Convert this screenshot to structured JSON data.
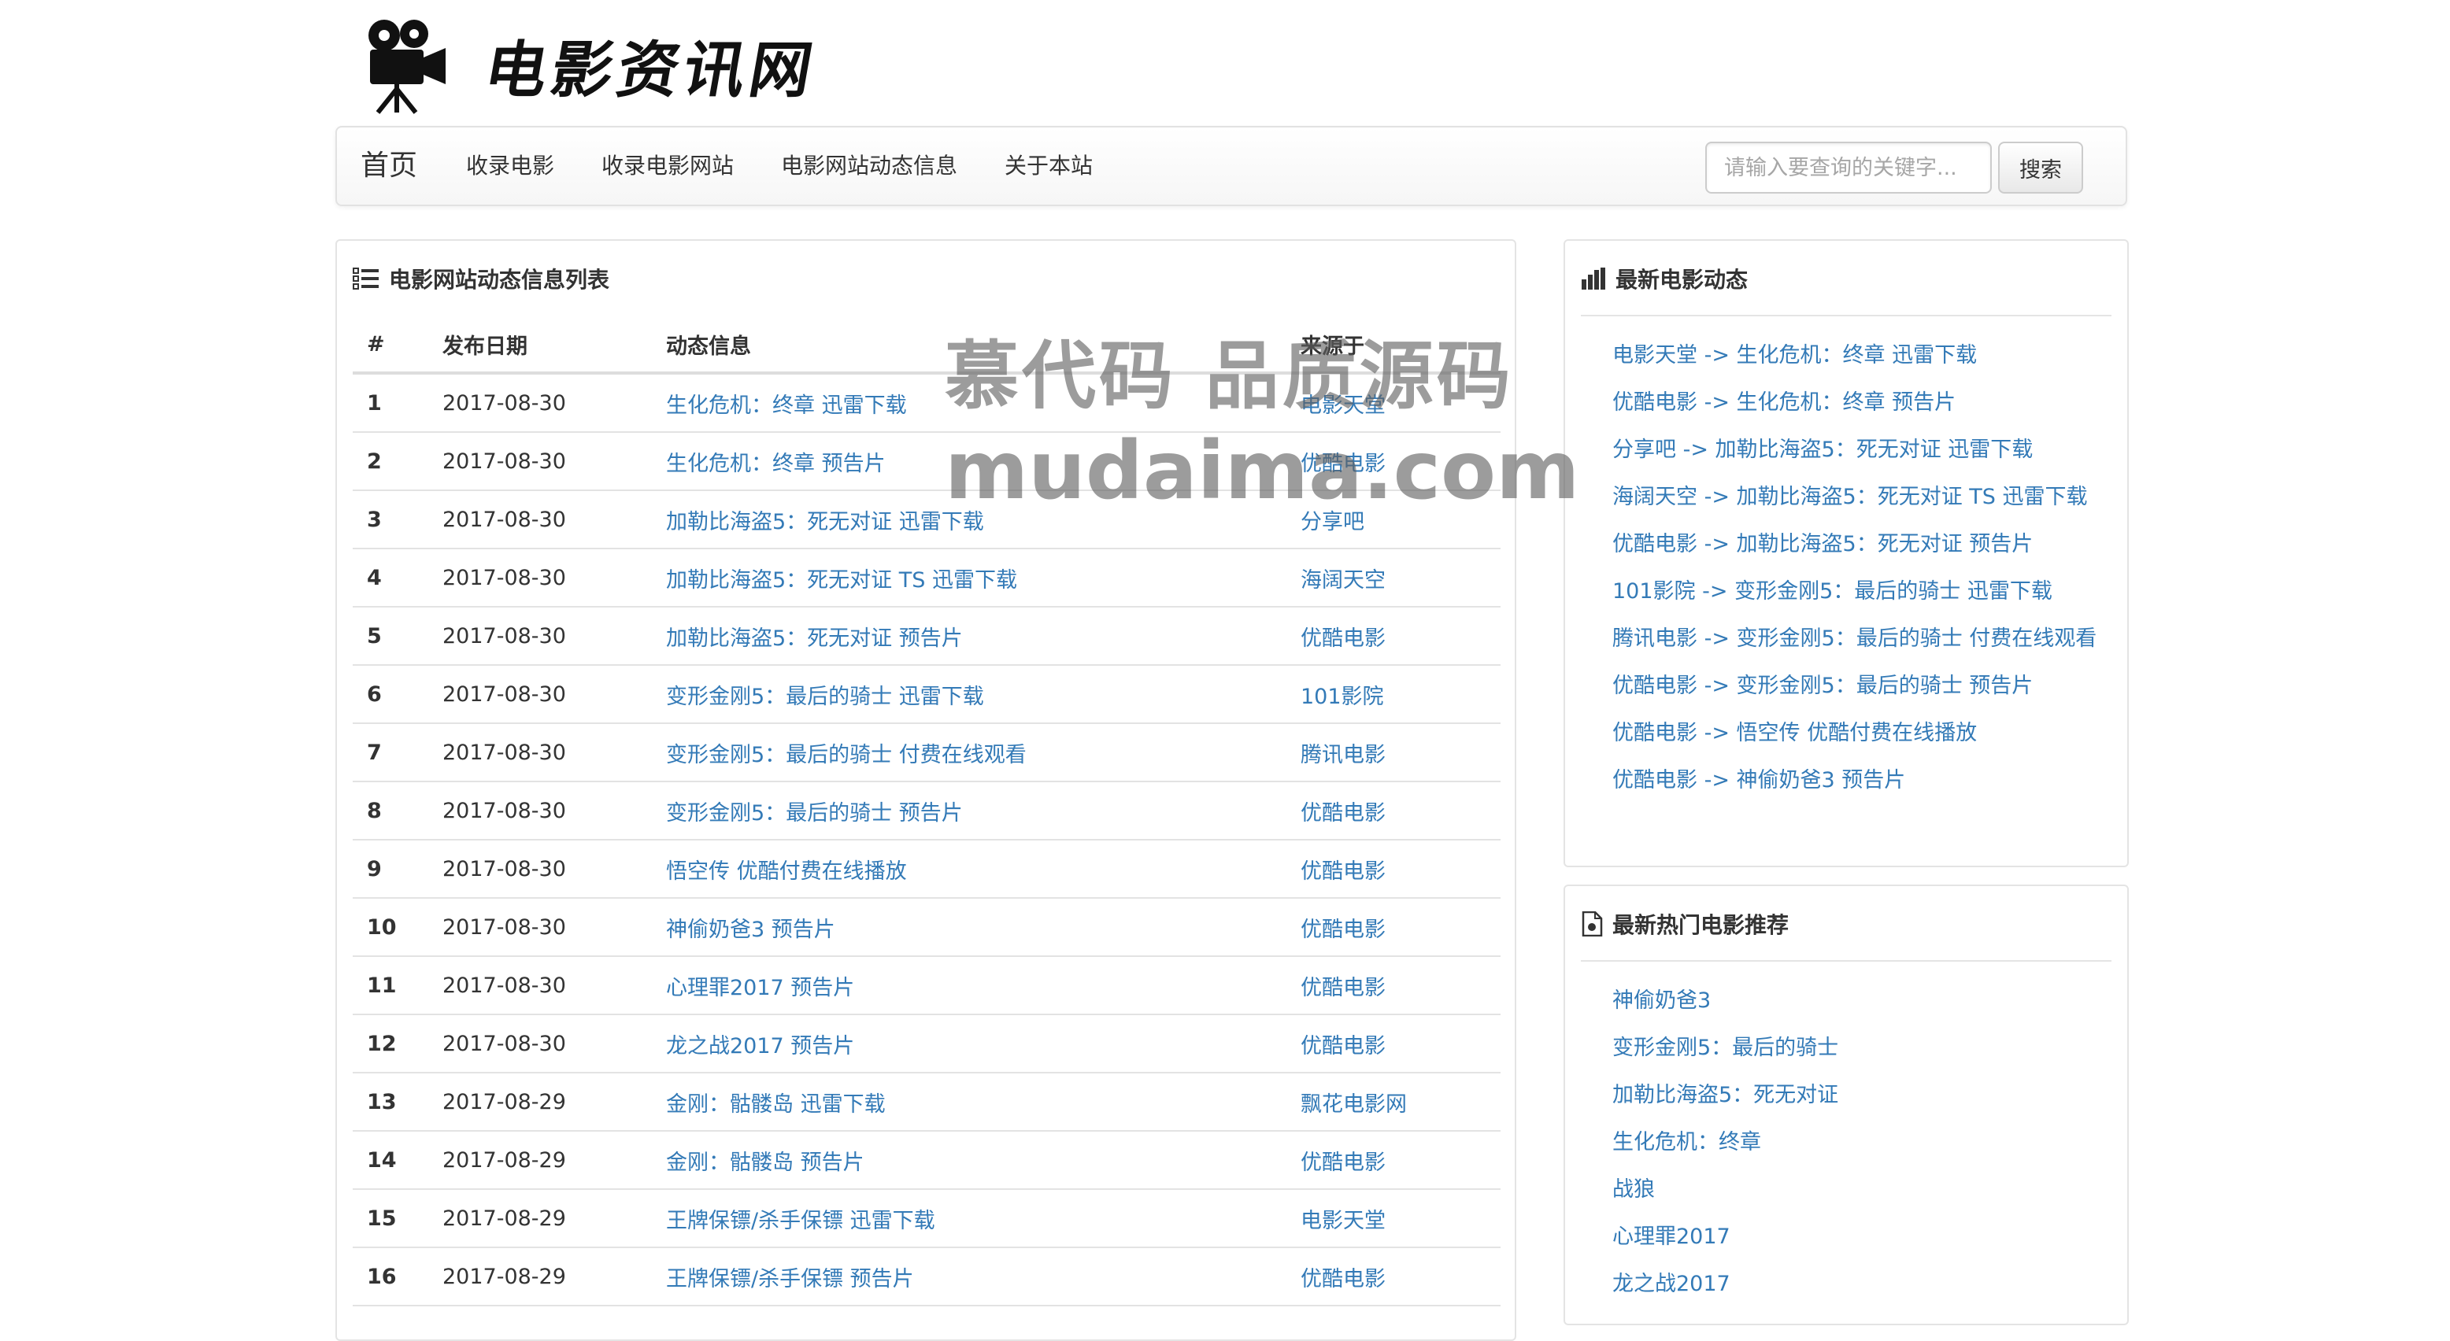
{
  "site": {
    "logo_text": "电影资讯网"
  },
  "navbar": {
    "brand": "首页",
    "links": [
      "收录电影",
      "收录电影网站",
      "电影网站动态信息",
      "关于本站"
    ],
    "search_placeholder": "请输入要查询的关键字...",
    "search_button": "搜索"
  },
  "main": {
    "title": "电影网站动态信息列表",
    "columns": [
      "#",
      "发布日期",
      "动态信息",
      "来源于"
    ],
    "rows": [
      {
        "num": "1",
        "date": "2017-08-30",
        "info": "生化危机：终章 迅雷下载",
        "source": "电影天堂"
      },
      {
        "num": "2",
        "date": "2017-08-30",
        "info": "生化危机：终章 预告片",
        "source": "优酷电影"
      },
      {
        "num": "3",
        "date": "2017-08-30",
        "info": "加勒比海盗5：死无对证 迅雷下载",
        "source": "分享吧"
      },
      {
        "num": "4",
        "date": "2017-08-30",
        "info": "加勒比海盗5：死无对证 TS 迅雷下载",
        "source": "海阔天空"
      },
      {
        "num": "5",
        "date": "2017-08-30",
        "info": "加勒比海盗5：死无对证 预告片",
        "source": "优酷电影"
      },
      {
        "num": "6",
        "date": "2017-08-30",
        "info": "变形金刚5：最后的骑士 迅雷下载",
        "source": "101影院"
      },
      {
        "num": "7",
        "date": "2017-08-30",
        "info": "变形金刚5：最后的骑士 付费在线观看",
        "source": "腾讯电影"
      },
      {
        "num": "8",
        "date": "2017-08-30",
        "info": "变形金刚5：最后的骑士 预告片",
        "source": "优酷电影"
      },
      {
        "num": "9",
        "date": "2017-08-30",
        "info": "悟空传 优酷付费在线播放",
        "source": "优酷电影"
      },
      {
        "num": "10",
        "date": "2017-08-30",
        "info": "神偷奶爸3 预告片",
        "source": "优酷电影"
      },
      {
        "num": "11",
        "date": "2017-08-30",
        "info": "心理罪2017 预告片",
        "source": "优酷电影"
      },
      {
        "num": "12",
        "date": "2017-08-30",
        "info": "龙之战2017 预告片",
        "source": "优酷电影"
      },
      {
        "num": "13",
        "date": "2017-08-29",
        "info": "金刚：骷髅岛 迅雷下载",
        "source": "飘花电影网"
      },
      {
        "num": "14",
        "date": "2017-08-29",
        "info": "金刚：骷髅岛 预告片",
        "source": "优酷电影"
      },
      {
        "num": "15",
        "date": "2017-08-29",
        "info": "王牌保镖/杀手保镖 迅雷下载",
        "source": "电影天堂"
      },
      {
        "num": "16",
        "date": "2017-08-29",
        "info": "王牌保镖/杀手保镖 预告片",
        "source": "优酷电影"
      }
    ]
  },
  "sidebar": {
    "news": {
      "title": "最新电影动态",
      "items": [
        "电影天堂 -> 生化危机：终章 迅雷下载",
        "优酷电影 -> 生化危机：终章 预告片",
        "分享吧 -> 加勒比海盗5：死无对证 迅雷下载",
        "海阔天空 -> 加勒比海盗5：死无对证 TS 迅雷下载",
        "优酷电影 -> 加勒比海盗5：死无对证 预告片",
        "101影院 -> 变形金刚5：最后的骑士 迅雷下载",
        "腾讯电影 -> 变形金刚5：最后的骑士 付费在线观看",
        "优酷电影 -> 变形金刚5：最后的骑士 预告片",
        "优酷电影 -> 悟空传 优酷付费在线播放",
        "优酷电影 -> 神偷奶爸3 预告片"
      ]
    },
    "hot": {
      "title": "最新热门电影推荐",
      "items": [
        "神偷奶爸3",
        "变形金刚5：最后的骑士",
        "加勒比海盗5：死无对证",
        "生化危机：终章",
        "战狼",
        "心理罪2017",
        "龙之战2017"
      ]
    }
  },
  "watermark": {
    "line1": "慕代码 品质源码",
    "line2": "mudaima.com"
  },
  "colors": {
    "link": "#337ab7",
    "text": "#333333",
    "border": "#e4e4e4",
    "navbar_bg": "#f8f8f8"
  }
}
